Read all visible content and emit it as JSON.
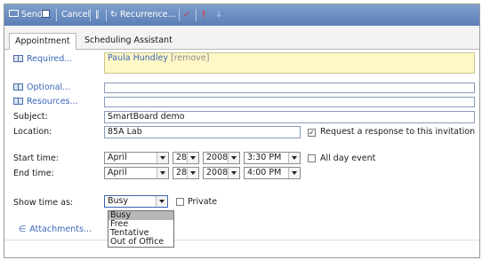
{
  "toolbar": {
    "send": "Send",
    "cancel": "Cancel",
    "recurrence": "Recurrence...",
    "bg": "#6b8ec4"
  },
  "tabs": [
    {
      "label": "Appointment"
    },
    {
      "label": "Scheduling Assistant"
    }
  ],
  "form": {
    "required_label": "Required...",
    "required_value": "Paula Hundley",
    "remove_link": "[remove]",
    "optional_label": "Optional...",
    "resources_label": "Resources...",
    "subject_label": "Subject:",
    "subject_value": "SmartBoard demo",
    "location_label": "Location:",
    "location_value": "85A Lab",
    "request_response_label": "Request a response to this invitation",
    "request_response_checked": true,
    "start_label": "Start time:",
    "start_month": "April",
    "start_day": "28",
    "start_year": "2008",
    "start_time": "3:30 PM",
    "all_day_label": "All day event",
    "end_label": "End time:",
    "end_month": "April",
    "end_day": "28",
    "end_year": "2008",
    "end_time": "4:00 PM",
    "show_time_label": "Show time as:",
    "show_time_value": "Busy",
    "private_label": "Private",
    "attachments_label": "Attachments..."
  },
  "show_time_options": [
    "Busy",
    "Free",
    "Tentative",
    "Out of Office"
  ],
  "colors": {
    "required_bg": "#fff7c6",
    "link": "#3b66b8"
  }
}
